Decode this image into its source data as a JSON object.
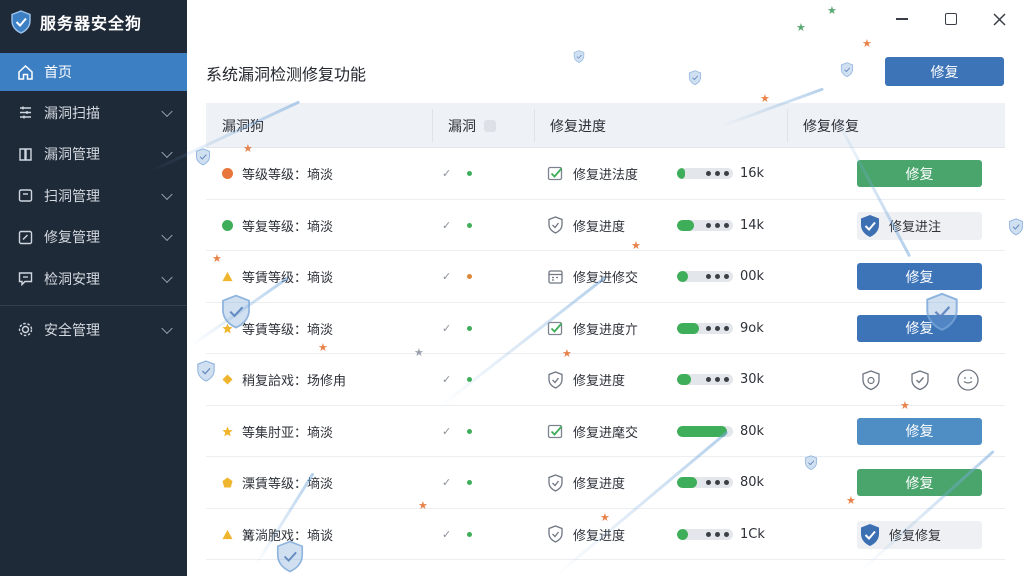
{
  "app": {
    "title": "服务器安全狗",
    "icon": "shield-icon"
  },
  "sidebar": {
    "items": [
      {
        "label": "首页",
        "icon": "home-icon",
        "active": true,
        "has_chevron": false
      },
      {
        "label": "漏洞扫描",
        "icon": "scan-list-icon",
        "active": false,
        "has_chevron": true
      },
      {
        "label": "漏洞管理",
        "icon": "book-icon",
        "active": false,
        "has_chevron": true
      },
      {
        "label": "扫洞管理",
        "icon": "box-icon",
        "active": false,
        "has_chevron": true
      },
      {
        "label": "修复管理",
        "icon": "edit-box-icon",
        "active": false,
        "has_chevron": true
      },
      {
        "label": "检洞安理",
        "icon": "chat-icon",
        "active": false,
        "has_chevron": true
      },
      {
        "label": "安全管理",
        "icon": "gear-icon",
        "active": false,
        "has_chevron": true
      }
    ]
  },
  "main": {
    "title": "系统漏洞检测修复功能",
    "repair_button": "修复",
    "table": {
      "headers": [
        "漏洞狗",
        "漏洞",
        "修复进度",
        "修复修复"
      ],
      "rows": [
        {
          "severity": "等级等级：墒淡",
          "sev_shape": "circle",
          "sev_color": "#e8753a",
          "dot": "green",
          "status_icon": "check-icon",
          "status": "修复进法度",
          "progress": 0.15,
          "value": "16k",
          "action": {
            "type": "button",
            "style": "green",
            "label": "修复"
          }
        },
        {
          "severity": "等复等级：墒淡",
          "sev_shape": "circle",
          "sev_color": "#3fae5a",
          "dot": "green",
          "status_icon": "shield-icon",
          "status": "修复进度",
          "progress": 0.3,
          "value": "14k",
          "action": {
            "type": "badge",
            "label": "修复进注"
          }
        },
        {
          "severity": "等賃等级：墒谈",
          "sev_shape": "triangle",
          "sev_color": "#f0b52e",
          "dot": "orange",
          "status_icon": "calendar-icon",
          "status": "修复进修交",
          "progress": 0.2,
          "value": "00k",
          "action": {
            "type": "button",
            "style": "blue",
            "label": "修复"
          }
        },
        {
          "severity": "等賃等级：墒淡",
          "sev_shape": "star",
          "sev_color": "#f0b52e",
          "dot": "green",
          "status_icon": "check-icon",
          "status": "修复进度亣",
          "progress": 0.4,
          "value": "9ok",
          "action": {
            "type": "button",
            "style": "blue",
            "label": "修复"
          }
        },
        {
          "severity": "稍复詥戏：场修甪",
          "sev_shape": "diamond",
          "sev_color": "#f0b52e",
          "dot": "green",
          "status_icon": "shield-icon",
          "status": "修复进度",
          "progress": 0.25,
          "value": "30k",
          "action": {
            "type": "icons",
            "icons": [
              "bug-shield-icon",
              "shield-check-icon",
              "smile-circle-icon"
            ]
          }
        },
        {
          "severity": "等集肘亚：墒淡",
          "sev_shape": "star",
          "sev_color": "#f0b52e",
          "dot": "green",
          "status_icon": "check-icon",
          "status": "修复进麾交",
          "progress": 0.9,
          "value": "80k",
          "action": {
            "type": "button",
            "style": "steel",
            "label": "修复"
          }
        },
        {
          "severity": "溧賃等级：墒淡",
          "sev_shape": "pentagon",
          "sev_color": "#f0b52e",
          "dot": "green",
          "status_icon": "shield-icon",
          "status": "修复进度",
          "progress": 0.35,
          "value": "80k",
          "action": {
            "type": "button",
            "style": "green",
            "label": "修复"
          }
        },
        {
          "severity": "篝淌胞戏：墒谈",
          "sev_shape": "triangle",
          "sev_color": "#f0b52e",
          "dot": "green",
          "status_icon": "shield-icon",
          "status": "修复进度",
          "progress": 0.2,
          "value": "1Ck",
          "action": {
            "type": "badge",
            "label": "修复修复"
          }
        }
      ]
    }
  }
}
